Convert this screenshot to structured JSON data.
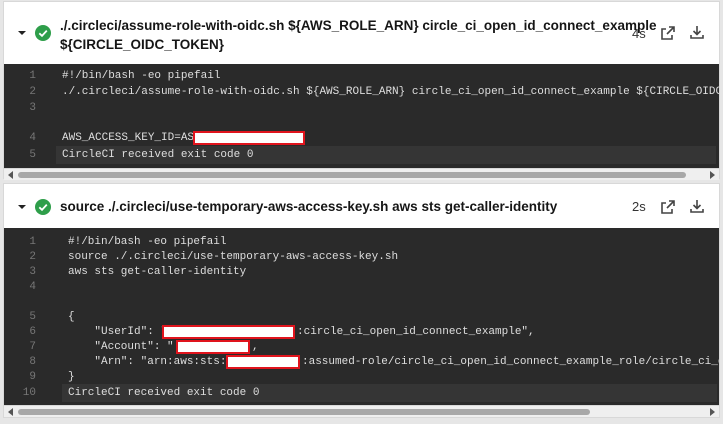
{
  "steps": [
    {
      "title_line1": "./.circleci/assume-role-with-oidc.sh ${AWS_ROLE_ARN} circle_ci_open_id_connect_example",
      "title_line2": "${CIRCLE_OIDC_TOKEN}",
      "duration": "4s",
      "lines": [
        {
          "n": "1",
          "text": "#!/bin/bash -eo pipefail"
        },
        {
          "n": "2",
          "text": "./.circleci/assume-role-with-oidc.sh ${AWS_ROLE_ARN} circle_ci_open_id_connect_example ${CIRCLE_OIDC_TOKEN}"
        },
        {
          "n": "3",
          "text": ""
        },
        {
          "n": "4",
          "text": "AWS_ACCESS_KEY_ID=ASI"
        },
        {
          "n": "5",
          "text": "CircleCI received exit code 0"
        }
      ]
    },
    {
      "title": "source ./.circleci/use-temporary-aws-access-key.sh aws sts get-caller-identity",
      "duration": "2s",
      "lines": [
        {
          "n": "1",
          "text": "#!/bin/bash -eo pipefail"
        },
        {
          "n": "2",
          "text": "source ./.circleci/use-temporary-aws-access-key.sh"
        },
        {
          "n": "3",
          "text": "aws sts get-caller-identity"
        },
        {
          "n": "4",
          "text": ""
        },
        {
          "n": "5",
          "text": "{"
        },
        {
          "n": "6",
          "text": "    \"UserId\": \"",
          "tail": ":circle_ci_open_id_connect_example\","
        },
        {
          "n": "7",
          "text": "    \"Account\": \"",
          "tail": ","
        },
        {
          "n": "8",
          "text": "    \"Arn\": \"arn:aws:sts::",
          "tail": ":assumed-role/circle_ci_open_id_connect_example_role/circle_ci_open_id_connect_example\""
        },
        {
          "n": "9",
          "text": "}"
        },
        {
          "n": "10",
          "text": "CircleCI received exit code 0"
        }
      ]
    }
  ],
  "icons": {
    "chevron": "chevron-down-icon",
    "status": "success-check-icon",
    "open": "open-in-new-icon",
    "download": "download-icon"
  },
  "colors": {
    "success": "#2e9e4a",
    "log_bg": "#2a2a2a",
    "redaction_border": "#e0141d"
  }
}
